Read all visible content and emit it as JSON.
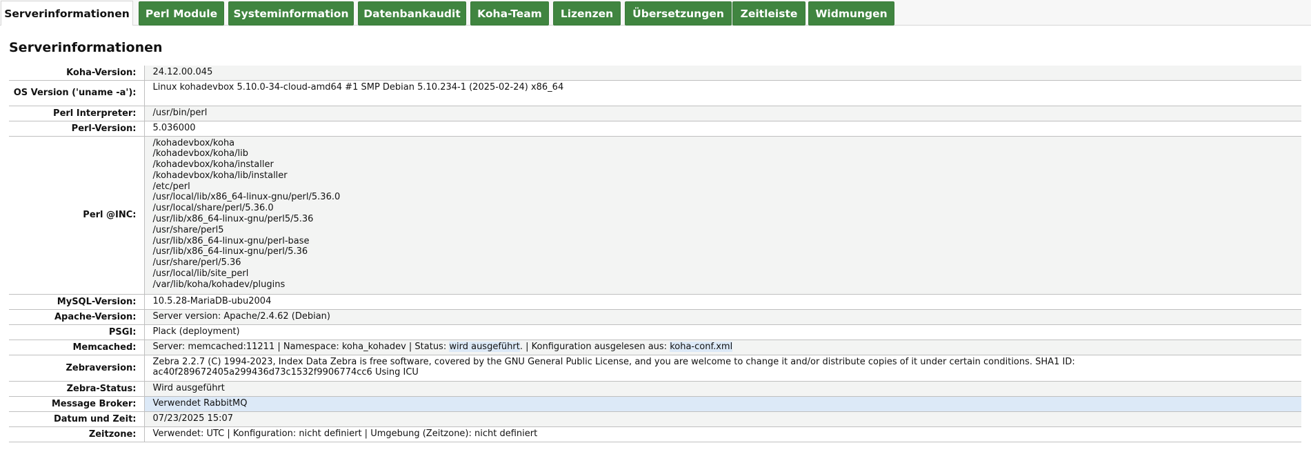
{
  "tabs": [
    {
      "label": "Serverinformationen",
      "active": true
    },
    {
      "label": "Perl Module"
    },
    {
      "label": "Systeminformation"
    },
    {
      "label": "Datenbankaudit"
    },
    {
      "label": "Koha-Team"
    },
    {
      "label": "Lizenzen"
    },
    {
      "label": "Übersetzungen"
    },
    {
      "label": "Zeitleiste"
    },
    {
      "label": "Widmungen"
    }
  ],
  "page_title": "Serverinformationen",
  "rows": {
    "koha_version": {
      "label": "Koha-Version:",
      "value": "24.12.00.045"
    },
    "os_version": {
      "label": "OS Version ('uname -a'):",
      "value": "Linux kohadevbox 5.10.0-34-cloud-amd64 #1 SMP Debian 5.10.234-1 (2025-02-24) x86_64"
    },
    "perl_interpreter": {
      "label": "Perl Interpreter:",
      "value": "/usr/bin/perl"
    },
    "perl_version": {
      "label": "Perl-Version:",
      "value": "5.036000"
    },
    "perl_inc": {
      "label": "Perl @INC:",
      "paths": [
        "/kohadevbox/koha",
        "/kohadevbox/koha/lib",
        "/kohadevbox/koha/installer",
        "/kohadevbox/koha/lib/installer",
        "/etc/perl",
        "/usr/local/lib/x86_64-linux-gnu/perl/5.36.0",
        "/usr/local/share/perl/5.36.0",
        "/usr/lib/x86_64-linux-gnu/perl5/5.36",
        "/usr/share/perl5",
        "/usr/lib/x86_64-linux-gnu/perl-base",
        "/usr/lib/x86_64-linux-gnu/perl/5.36",
        "/usr/share/perl/5.36",
        "/usr/local/lib/site_perl",
        "/var/lib/koha/kohadev/plugins"
      ]
    },
    "mysql_version": {
      "label": "MySQL-Version:",
      "value": "10.5.28-MariaDB-ubu2004"
    },
    "apache_version": {
      "label": "Apache-Version:",
      "value": "Server version: Apache/2.4.62 (Debian)"
    },
    "psgi": {
      "label": "PSGI:",
      "value": "Plack (deployment)"
    },
    "memcached": {
      "label": "Memcached:",
      "prefix": "Server: memcached:11211 | Namespace: koha_kohadev | Status: ",
      "status": "wird ausgeführt",
      "middle": ". | Konfiguration ausgelesen aus: ",
      "config": "koha-conf.xml"
    },
    "zebra_version": {
      "label": "Zebraversion:",
      "value": "Zebra 2.2.7 (C) 1994-2023, Index Data Zebra is free software, covered by the GNU General Public License, and you are welcome to change it and/or distribute copies of it under certain conditions. SHA1 ID: ac40f289672405a299436d73c1532f9906774cc6 Using ICU"
    },
    "zebra_status": {
      "label": "Zebra-Status:",
      "value": "Wird ausgeführt"
    },
    "message_broker": {
      "label": "Message Broker:",
      "value": "Verwendet RabbitMQ"
    },
    "datetime": {
      "label": "Datum und Zeit:",
      "value": "07/23/2025 15:07"
    },
    "timezone": {
      "label": "Zeitzone:",
      "value": "Verwendet: UTC | Konfiguration: nicht definiert | Umgebung (Zeitzone): nicht definiert"
    }
  },
  "colors": {
    "tab_green": "#408540",
    "highlight_blue": "#dce9f7",
    "row_stripe": "#f3f4f3"
  }
}
